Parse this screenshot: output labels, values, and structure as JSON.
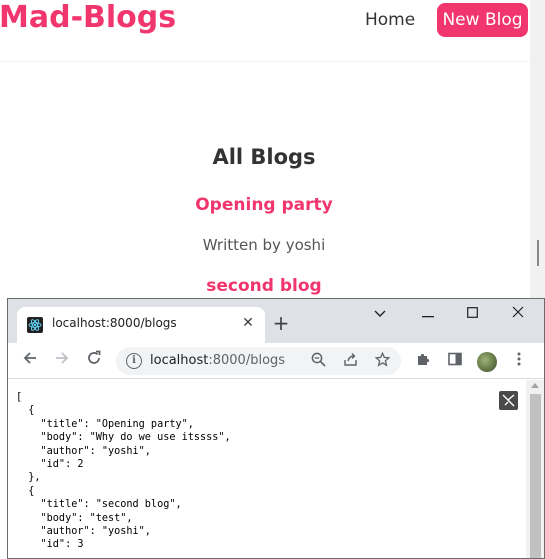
{
  "app": {
    "brand": "Mad-Blogs",
    "nav": {
      "home": "Home",
      "new_blog": "New Blog"
    },
    "heading": "All Blogs",
    "blogs": [
      {
        "title": "Opening party",
        "byline": "Written by yoshi"
      },
      {
        "title": "second blog"
      }
    ]
  },
  "browser": {
    "tab_title": "localhost:8000/blogs",
    "url_host": "localhost",
    "url_rest": ":8000/blogs",
    "json_text": "[\n  {\n    \"title\": \"Opening party\",\n    \"body\": \"Why do we use itssss\",\n    \"author\": \"yoshi\",\n    \"id\": 2\n  },\n  {\n    \"title\": \"second blog\",\n    \"body\": \"test\",\n    \"author\": \"yoshi\",\n    \"id\": 3"
  },
  "colors": {
    "accent": "#f1356d",
    "text": "#333333"
  }
}
